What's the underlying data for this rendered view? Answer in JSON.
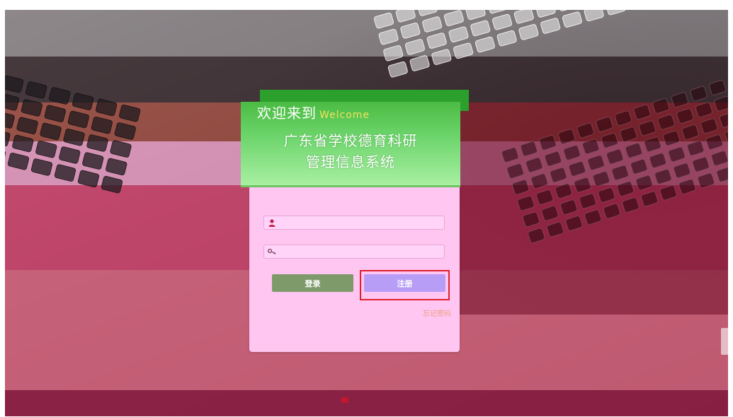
{
  "header": {
    "welcome_cn": "欢迎来到",
    "welcome_en": "Welcome"
  },
  "system": {
    "title_line1": "广东省学校德育科研",
    "title_line2": "管理信息系统"
  },
  "form": {
    "username_value": "",
    "password_value": "",
    "user_icon": "user-icon",
    "key_icon": "key-icon"
  },
  "buttons": {
    "login_label": "登录",
    "register_label": "注册"
  },
  "links": {
    "forgot_password": "忘记密码"
  },
  "colors": {
    "header_green": "#2ca02c",
    "card_pink": "#ffc6f2",
    "login_button": "#7e9a6a",
    "register_button": "#b89df7",
    "highlight_red": "#e0202a"
  }
}
